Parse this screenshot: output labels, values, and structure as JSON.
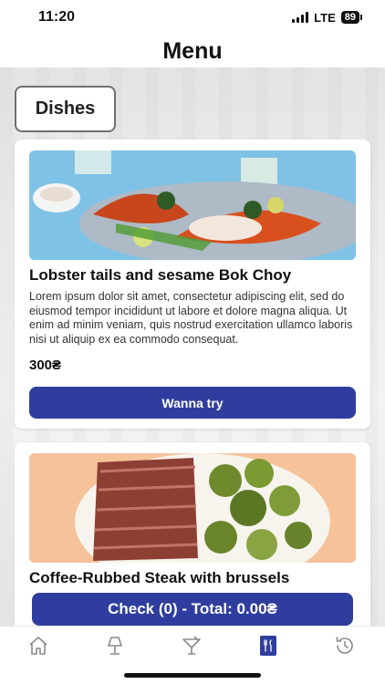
{
  "status_bar": {
    "time": "11:20",
    "network": "LTE",
    "battery": "89"
  },
  "header": {
    "title": "Menu"
  },
  "section": {
    "label": "Dishes"
  },
  "dishes": [
    {
      "title": "Lobster tails and sesame Bok Choy",
      "description": "Lorem ipsum dolor sit amet, consectetur adipiscing elit, sed do eiusmod tempor incididunt ut labore et dolore magna aliqua. Ut enim ad minim veniam, quis nostrud exercitation ullamco laboris nisi ut aliquip ex ea commodo consequat.",
      "price": "300₴",
      "button_label": "Wanna try",
      "image": "lobster-dish-photo"
    },
    {
      "title": "Coffee-Rubbed Steak with brussels",
      "image": "steak-dish-photo"
    }
  ],
  "checkout": {
    "label": "Check (0) - Total: 0.00₴"
  },
  "tabs": [
    {
      "icon": "home-icon",
      "active": false
    },
    {
      "icon": "lamp-icon",
      "active": false
    },
    {
      "icon": "cocktail-icon",
      "active": false
    },
    {
      "icon": "menu-book-icon",
      "active": true
    },
    {
      "icon": "history-icon",
      "active": false
    }
  ],
  "colors": {
    "accent": "#2f3e9e",
    "tab_inactive": "#8a8a8a"
  }
}
